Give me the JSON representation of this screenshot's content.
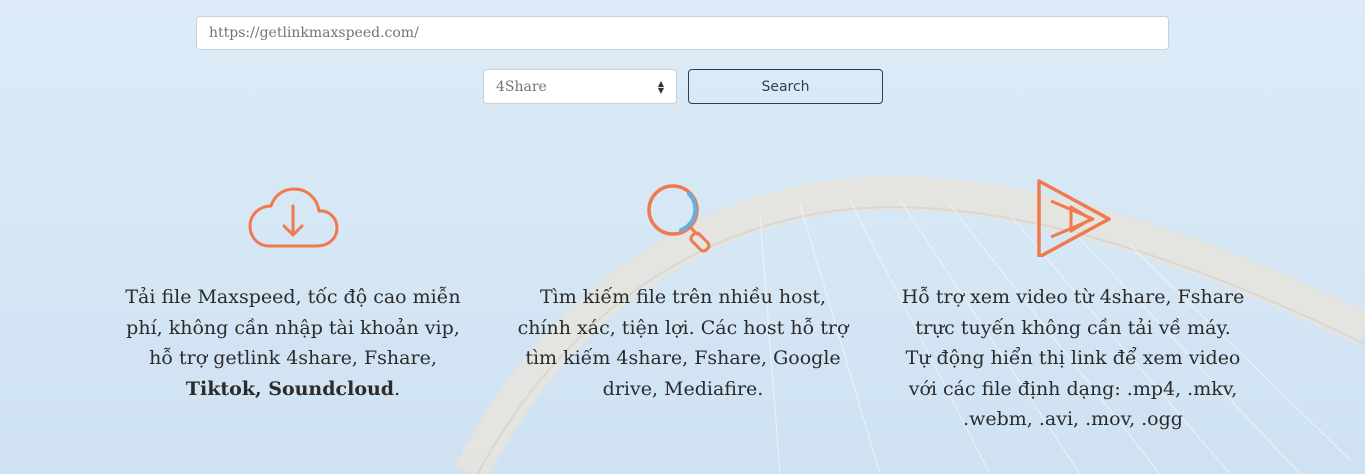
{
  "search": {
    "value": "https://getlinkmaxspeed.com/",
    "placeholder": ""
  },
  "host_select": {
    "selected": "4Share"
  },
  "search_button": {
    "label": "Search"
  },
  "features": [
    {
      "icon": "cloud-download-icon",
      "text_before": "Tải file Maxspeed, tốc độ cao miễn phí, không cần nhập tài khoản vip, hỗ trợ getlink 4share, Fshare, ",
      "text_bold": "Tiktok, Soundcloud",
      "text_after": "."
    },
    {
      "icon": "magnifier-icon",
      "text": "Tìm kiếm file trên nhiều host, chính xác, tiện lợi. Các host hỗ trợ tìm kiếm 4share, Fshare, Google drive, Mediafire."
    },
    {
      "icon": "video-play-icon",
      "text": "Hỗ trợ xem video từ 4share, Fshare trực tuyến không cần tải về máy. Tự động hiển thị link để xem video với các file định dạng: .mp4, .mkv, .webm, .avi, .mov, .ogg"
    }
  ],
  "colors": {
    "accent": "#f07a4f",
    "accent_blue": "#64b0e6",
    "text": "#2b2b2b",
    "button_border": "#2f3f53",
    "background": "#d8e8f6"
  }
}
